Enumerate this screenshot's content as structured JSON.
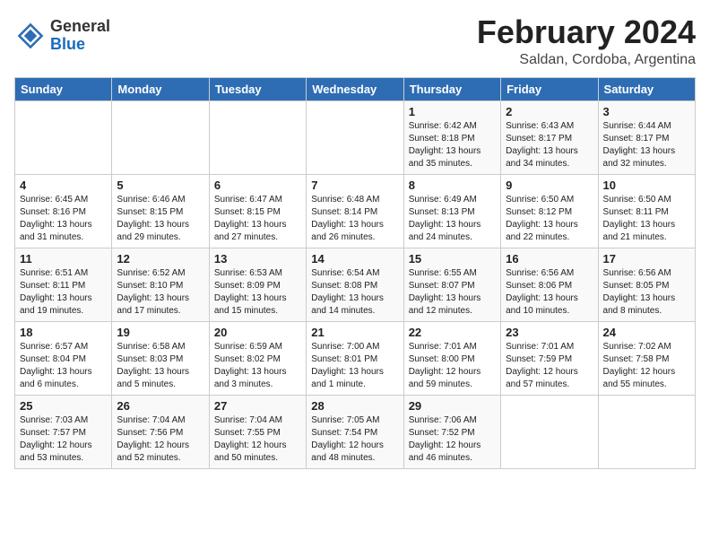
{
  "header": {
    "logo_general": "General",
    "logo_blue": "Blue",
    "month_title": "February 2024",
    "location": "Saldan, Cordoba, Argentina"
  },
  "days_of_week": [
    "Sunday",
    "Monday",
    "Tuesday",
    "Wednesday",
    "Thursday",
    "Friday",
    "Saturday"
  ],
  "weeks": [
    [
      {
        "day": "",
        "info": ""
      },
      {
        "day": "",
        "info": ""
      },
      {
        "day": "",
        "info": ""
      },
      {
        "day": "",
        "info": ""
      },
      {
        "day": "1",
        "info": "Sunrise: 6:42 AM\nSunset: 8:18 PM\nDaylight: 13 hours\nand 35 minutes."
      },
      {
        "day": "2",
        "info": "Sunrise: 6:43 AM\nSunset: 8:17 PM\nDaylight: 13 hours\nand 34 minutes."
      },
      {
        "day": "3",
        "info": "Sunrise: 6:44 AM\nSunset: 8:17 PM\nDaylight: 13 hours\nand 32 minutes."
      }
    ],
    [
      {
        "day": "4",
        "info": "Sunrise: 6:45 AM\nSunset: 8:16 PM\nDaylight: 13 hours\nand 31 minutes."
      },
      {
        "day": "5",
        "info": "Sunrise: 6:46 AM\nSunset: 8:15 PM\nDaylight: 13 hours\nand 29 minutes."
      },
      {
        "day": "6",
        "info": "Sunrise: 6:47 AM\nSunset: 8:15 PM\nDaylight: 13 hours\nand 27 minutes."
      },
      {
        "day": "7",
        "info": "Sunrise: 6:48 AM\nSunset: 8:14 PM\nDaylight: 13 hours\nand 26 minutes."
      },
      {
        "day": "8",
        "info": "Sunrise: 6:49 AM\nSunset: 8:13 PM\nDaylight: 13 hours\nand 24 minutes."
      },
      {
        "day": "9",
        "info": "Sunrise: 6:50 AM\nSunset: 8:12 PM\nDaylight: 13 hours\nand 22 minutes."
      },
      {
        "day": "10",
        "info": "Sunrise: 6:50 AM\nSunset: 8:11 PM\nDaylight: 13 hours\nand 21 minutes."
      }
    ],
    [
      {
        "day": "11",
        "info": "Sunrise: 6:51 AM\nSunset: 8:11 PM\nDaylight: 13 hours\nand 19 minutes."
      },
      {
        "day": "12",
        "info": "Sunrise: 6:52 AM\nSunset: 8:10 PM\nDaylight: 13 hours\nand 17 minutes."
      },
      {
        "day": "13",
        "info": "Sunrise: 6:53 AM\nSunset: 8:09 PM\nDaylight: 13 hours\nand 15 minutes."
      },
      {
        "day": "14",
        "info": "Sunrise: 6:54 AM\nSunset: 8:08 PM\nDaylight: 13 hours\nand 14 minutes."
      },
      {
        "day": "15",
        "info": "Sunrise: 6:55 AM\nSunset: 8:07 PM\nDaylight: 13 hours\nand 12 minutes."
      },
      {
        "day": "16",
        "info": "Sunrise: 6:56 AM\nSunset: 8:06 PM\nDaylight: 13 hours\nand 10 minutes."
      },
      {
        "day": "17",
        "info": "Sunrise: 6:56 AM\nSunset: 8:05 PM\nDaylight: 13 hours\nand 8 minutes."
      }
    ],
    [
      {
        "day": "18",
        "info": "Sunrise: 6:57 AM\nSunset: 8:04 PM\nDaylight: 13 hours\nand 6 minutes."
      },
      {
        "day": "19",
        "info": "Sunrise: 6:58 AM\nSunset: 8:03 PM\nDaylight: 13 hours\nand 5 minutes."
      },
      {
        "day": "20",
        "info": "Sunrise: 6:59 AM\nSunset: 8:02 PM\nDaylight: 13 hours\nand 3 minutes."
      },
      {
        "day": "21",
        "info": "Sunrise: 7:00 AM\nSunset: 8:01 PM\nDaylight: 13 hours\nand 1 minute."
      },
      {
        "day": "22",
        "info": "Sunrise: 7:01 AM\nSunset: 8:00 PM\nDaylight: 12 hours\nand 59 minutes."
      },
      {
        "day": "23",
        "info": "Sunrise: 7:01 AM\nSunset: 7:59 PM\nDaylight: 12 hours\nand 57 minutes."
      },
      {
        "day": "24",
        "info": "Sunrise: 7:02 AM\nSunset: 7:58 PM\nDaylight: 12 hours\nand 55 minutes."
      }
    ],
    [
      {
        "day": "25",
        "info": "Sunrise: 7:03 AM\nSunset: 7:57 PM\nDaylight: 12 hours\nand 53 minutes."
      },
      {
        "day": "26",
        "info": "Sunrise: 7:04 AM\nSunset: 7:56 PM\nDaylight: 12 hours\nand 52 minutes."
      },
      {
        "day": "27",
        "info": "Sunrise: 7:04 AM\nSunset: 7:55 PM\nDaylight: 12 hours\nand 50 minutes."
      },
      {
        "day": "28",
        "info": "Sunrise: 7:05 AM\nSunset: 7:54 PM\nDaylight: 12 hours\nand 48 minutes."
      },
      {
        "day": "29",
        "info": "Sunrise: 7:06 AM\nSunset: 7:52 PM\nDaylight: 12 hours\nand 46 minutes."
      },
      {
        "day": "",
        "info": ""
      },
      {
        "day": "",
        "info": ""
      }
    ]
  ]
}
